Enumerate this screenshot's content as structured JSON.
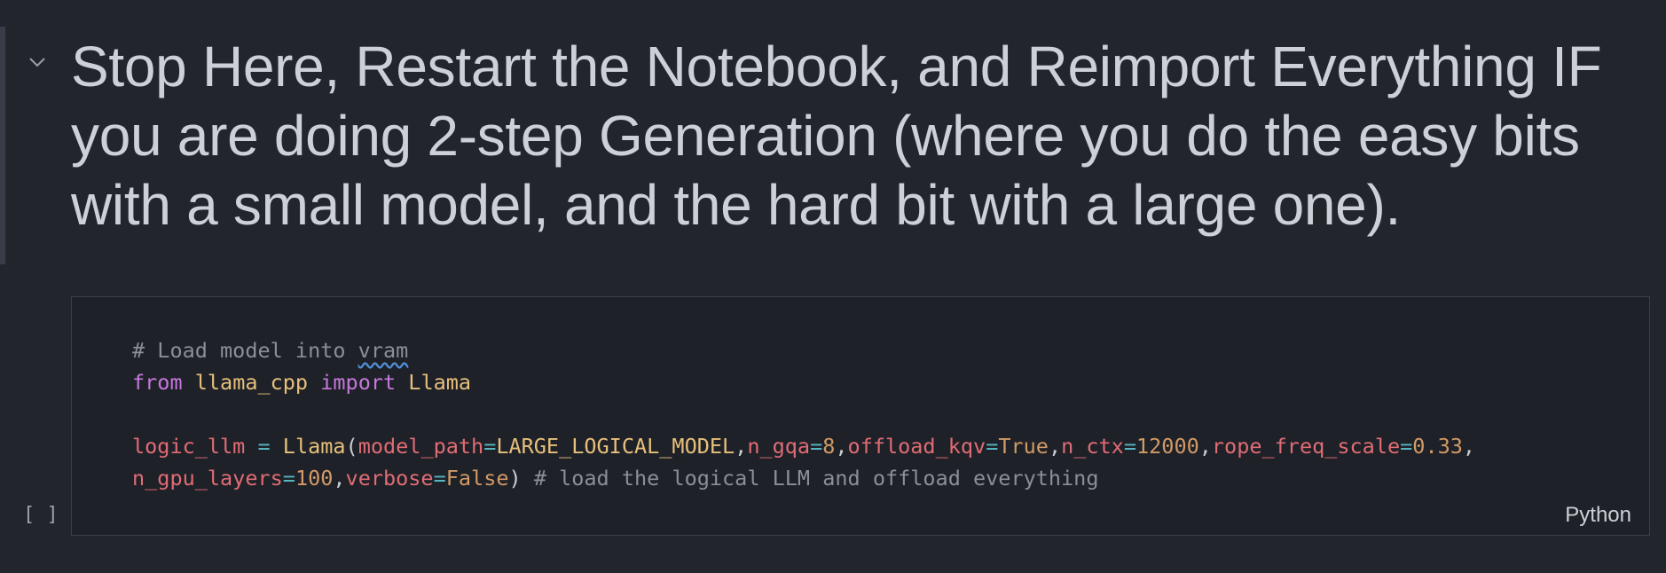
{
  "markdown_cell": {
    "heading": "Stop Here, Restart the Notebook, and Reimport Everything IF you are doing 2-step Generation (where you do the easy bits with a small model, and the hard bit with a large one).",
    "collapse_icon": "chevron-down-icon"
  },
  "code_cell": {
    "execution_count": "[ ]",
    "language": "Python",
    "code": {
      "l1_comment_prefix": "# Load model into ",
      "l1_comment_word": "vram",
      "l2_from": "from",
      "l2_module": "llama_cpp",
      "l2_import": "import",
      "l2_class": "Llama",
      "l4_var": "logic_llm",
      "l4_eq": " = ",
      "l4_class": "Llama",
      "l4_paren_open": "(",
      "p1_name": "model_path",
      "p1_value": "LARGE_LOGICAL_MODEL",
      "p2_name": "n_gqa",
      "p2_value": "8",
      "p3_name": "offload_kqv",
      "p3_value": "True",
      "p4_name": "n_ctx",
      "p4_value": "12000",
      "p5_name": "rope_freq_scale",
      "p5_value": "0.33",
      "p6_name": "n_gpu_layers",
      "p6_value": "100",
      "p7_name": "verbose",
      "p7_value": "False",
      "paren_close": ")",
      "l5_comment": "# load the logical LLM and offload everything",
      "eq": "=",
      "comma": ","
    }
  },
  "colors": {
    "background": "#23252d",
    "code_background": "#1f2128",
    "keyword": "#c678dd",
    "class": "#e6c07b",
    "variable": "#e06c75",
    "number": "#d19a66",
    "comment": "#8a8f98"
  }
}
